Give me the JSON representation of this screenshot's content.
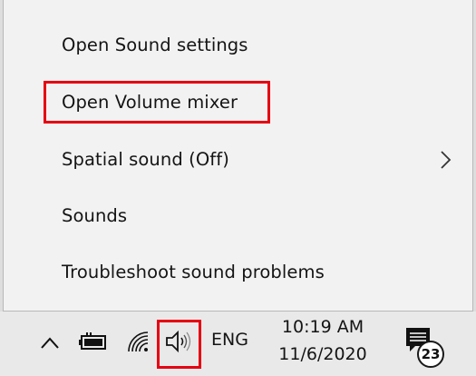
{
  "menu": {
    "items": [
      {
        "label": "Open Sound settings"
      },
      {
        "label": "Open Volume mixer"
      },
      {
        "label": "Spatial sound (Off)"
      },
      {
        "label": "Sounds"
      },
      {
        "label": "Troubleshoot sound problems"
      }
    ]
  },
  "taskbar": {
    "language": "ENG",
    "time": "10:19 AM",
    "date": "11/6/2020",
    "notification_count": "23",
    "icons": [
      "chevron-up-icon",
      "battery-icon",
      "wifi-icon",
      "speaker-icon",
      "notification-icon"
    ]
  },
  "colors": {
    "highlight": "#e60012",
    "menu_background": "#f2f2f2",
    "taskbar_background": "#e9e9e9"
  }
}
